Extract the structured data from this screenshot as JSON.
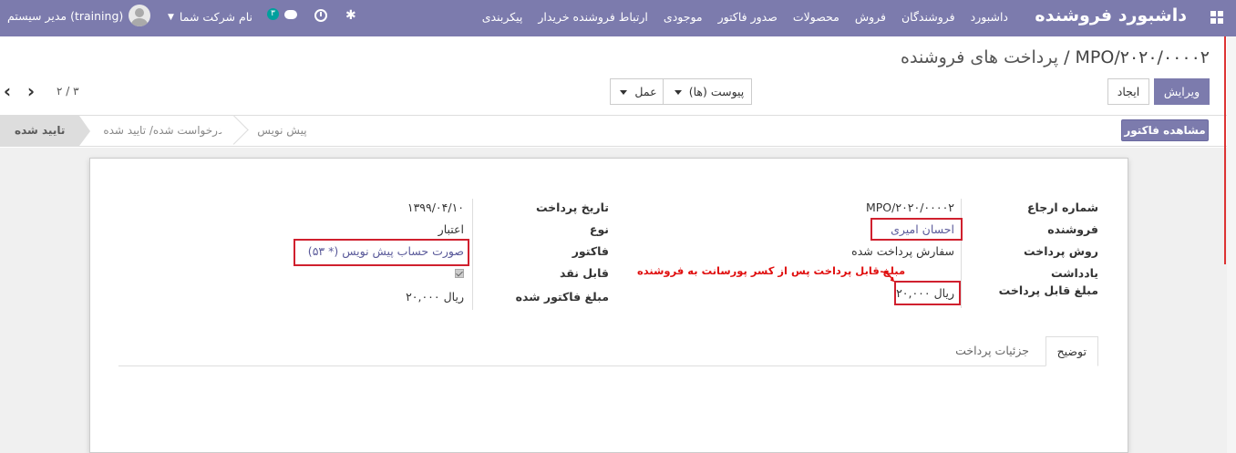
{
  "navbar": {
    "brand": "داشبورد فروشنده",
    "menu": [
      "داشبورد",
      "فروشندگان",
      "فروش",
      "محصولات",
      "صدور فاکتور",
      "موجودی",
      "ارتباط فروشنده خریدار",
      "پیکربندی"
    ],
    "user_name": "مدیر سیستم (training)",
    "company": "نام شرکت شما",
    "chat_count": "۳",
    "icons": [
      "apps-icon",
      "chat-icon",
      "clock-icon",
      "bug-icon",
      "avatar"
    ]
  },
  "breadcrumb": {
    "parent": "پرداخت های فروشنده",
    "separator": "/",
    "current": "MPO/۲۰۲۰/۰۰۰۰۲"
  },
  "buttons": {
    "edit": "ویرایش",
    "create": "ایجاد",
    "attachment": "پیوست (ها)",
    "action": "عمل",
    "view_invoice": "مشاهده فاکتور"
  },
  "pager": {
    "text": "۲ / ۳"
  },
  "status_steps": [
    "تایید شده",
    "درخواست شده/ تایید شده",
    "پیش نویس"
  ],
  "form": {
    "left_labels": [
      "شماره ارجاع",
      "فروشنده",
      "روش پرداخت",
      "یادداشت",
      "مبلغ قابل پرداخت"
    ],
    "left_values": {
      "reference": "MPO/۲۰۲۰/۰۰۰۰۲",
      "vendor": "احسان امیری",
      "method": "سفارش پرداخت شده",
      "payable": "۲۰,۰۰۰ ریال"
    },
    "right_labels": [
      "تاریخ پرداخت",
      "نوع",
      "فاکتور",
      "قابل نقد",
      "مبلغ فاکتور شده"
    ],
    "right_values": {
      "date": "۱۳۹۹/۰۴/۱۰",
      "type": "اعتبار",
      "invoice": "صورت حساب پیش نویس (* ۵۳)",
      "invoiced_amount": "۲۰,۰۰۰ ریال"
    },
    "annotation": "مبلغ قابل پرداخت پس از کسر پورسانت به فروشنده"
  },
  "tabs": [
    "توضیح",
    "جزئیات پرداخت"
  ],
  "colors": {
    "primary": "#7c7bad",
    "highlight": "#d0202e"
  }
}
